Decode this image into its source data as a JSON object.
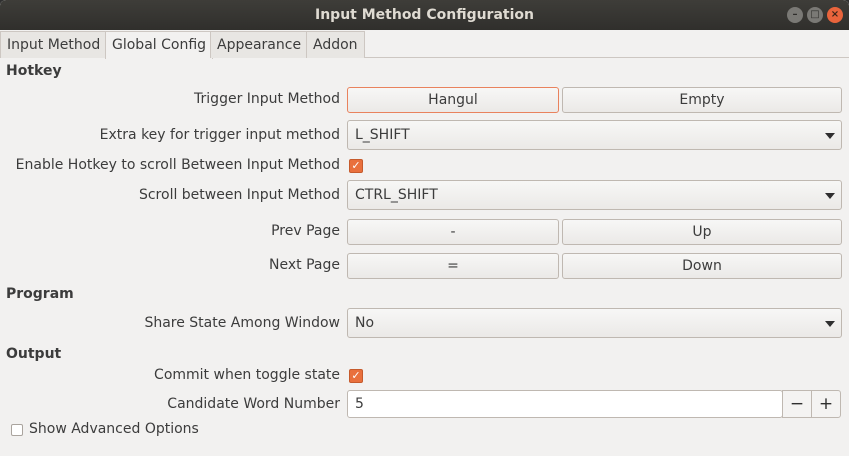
{
  "window": {
    "title": "Input Method Configuration",
    "buttons": {
      "minimize": "–",
      "maximize": "□",
      "close": "×"
    }
  },
  "tabs": [
    {
      "label": "Input Method",
      "active": false
    },
    {
      "label": "Global Config",
      "active": true
    },
    {
      "label": "Appearance",
      "active": false
    },
    {
      "label": "Addon",
      "active": false
    }
  ],
  "hotkey": {
    "section_title": "Hotkey",
    "trigger": {
      "label": "Trigger Input Method",
      "key1": "Hangul",
      "key2": "Empty"
    },
    "extra_key": {
      "label": "Extra key for trigger input method",
      "value": "L_SHIFT"
    },
    "enable_scroll": {
      "label": "Enable Hotkey to scroll Between Input Method",
      "checked": true
    },
    "scroll_between": {
      "label": "Scroll between Input Method",
      "value": "CTRL_SHIFT"
    },
    "prev_page": {
      "label": "Prev Page",
      "key1": "-",
      "key2": "Up"
    },
    "next_page": {
      "label": "Next Page",
      "key1": "=",
      "key2": "Down"
    }
  },
  "program": {
    "section_title": "Program",
    "share_state": {
      "label": "Share State Among Window",
      "value": "No"
    }
  },
  "output": {
    "section_title": "Output",
    "commit_toggle": {
      "label": "Commit when toggle state",
      "checked": true
    },
    "candidate_number": {
      "label": "Candidate Word Number",
      "value": "5",
      "decrement": "−",
      "increment": "+"
    }
  },
  "advanced": {
    "label": "Show Advanced Options",
    "checked": false
  },
  "colors": {
    "accent": "#e9703d",
    "titlebar": "#3b3a36",
    "background": "#f2f1f0"
  },
  "icons": {
    "dropdown": "chevron-down-icon",
    "check": "checkmark-icon"
  }
}
